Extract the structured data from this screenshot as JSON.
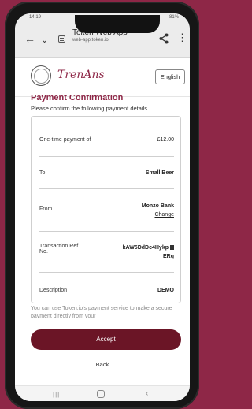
{
  "status_bar": {
    "time": "14:19",
    "battery": "81%"
  },
  "browser": {
    "title": "Token Web App",
    "url": "web-app.token.io"
  },
  "header": {
    "logo_text": "TrenAns",
    "language_button": "English"
  },
  "page": {
    "heading": "Payment Confirmation",
    "instructions": "Please confirm the following payment details"
  },
  "details": {
    "rows": [
      {
        "label": "One-time payment of",
        "value": "£12.00"
      },
      {
        "label": "To",
        "value": "Small Beer"
      },
      {
        "label": "From",
        "value": "Monzo Bank",
        "action": "Change"
      },
      {
        "label_line1": "Transaction Ref",
        "label_line2": "No.",
        "value_line1": "kAW5DdDc4Hykp",
        "value_line2": "ERq"
      },
      {
        "label": "Description",
        "value": "DEMO"
      }
    ]
  },
  "info": {
    "text": "You can use Token.io's payment service to make a secure payment directly from your"
  },
  "footer": {
    "accept_label": "Accept",
    "back_label": "Back"
  },
  "icons": {
    "back": "back-arrow-icon",
    "dropdown": "chevron-down-icon",
    "site": "site-settings-icon",
    "share": "share-icon",
    "menu": "more-vert-icon",
    "copy": "copy-icon"
  },
  "colors": {
    "brand": "#8e2747",
    "accept_button": "#6b1526"
  }
}
